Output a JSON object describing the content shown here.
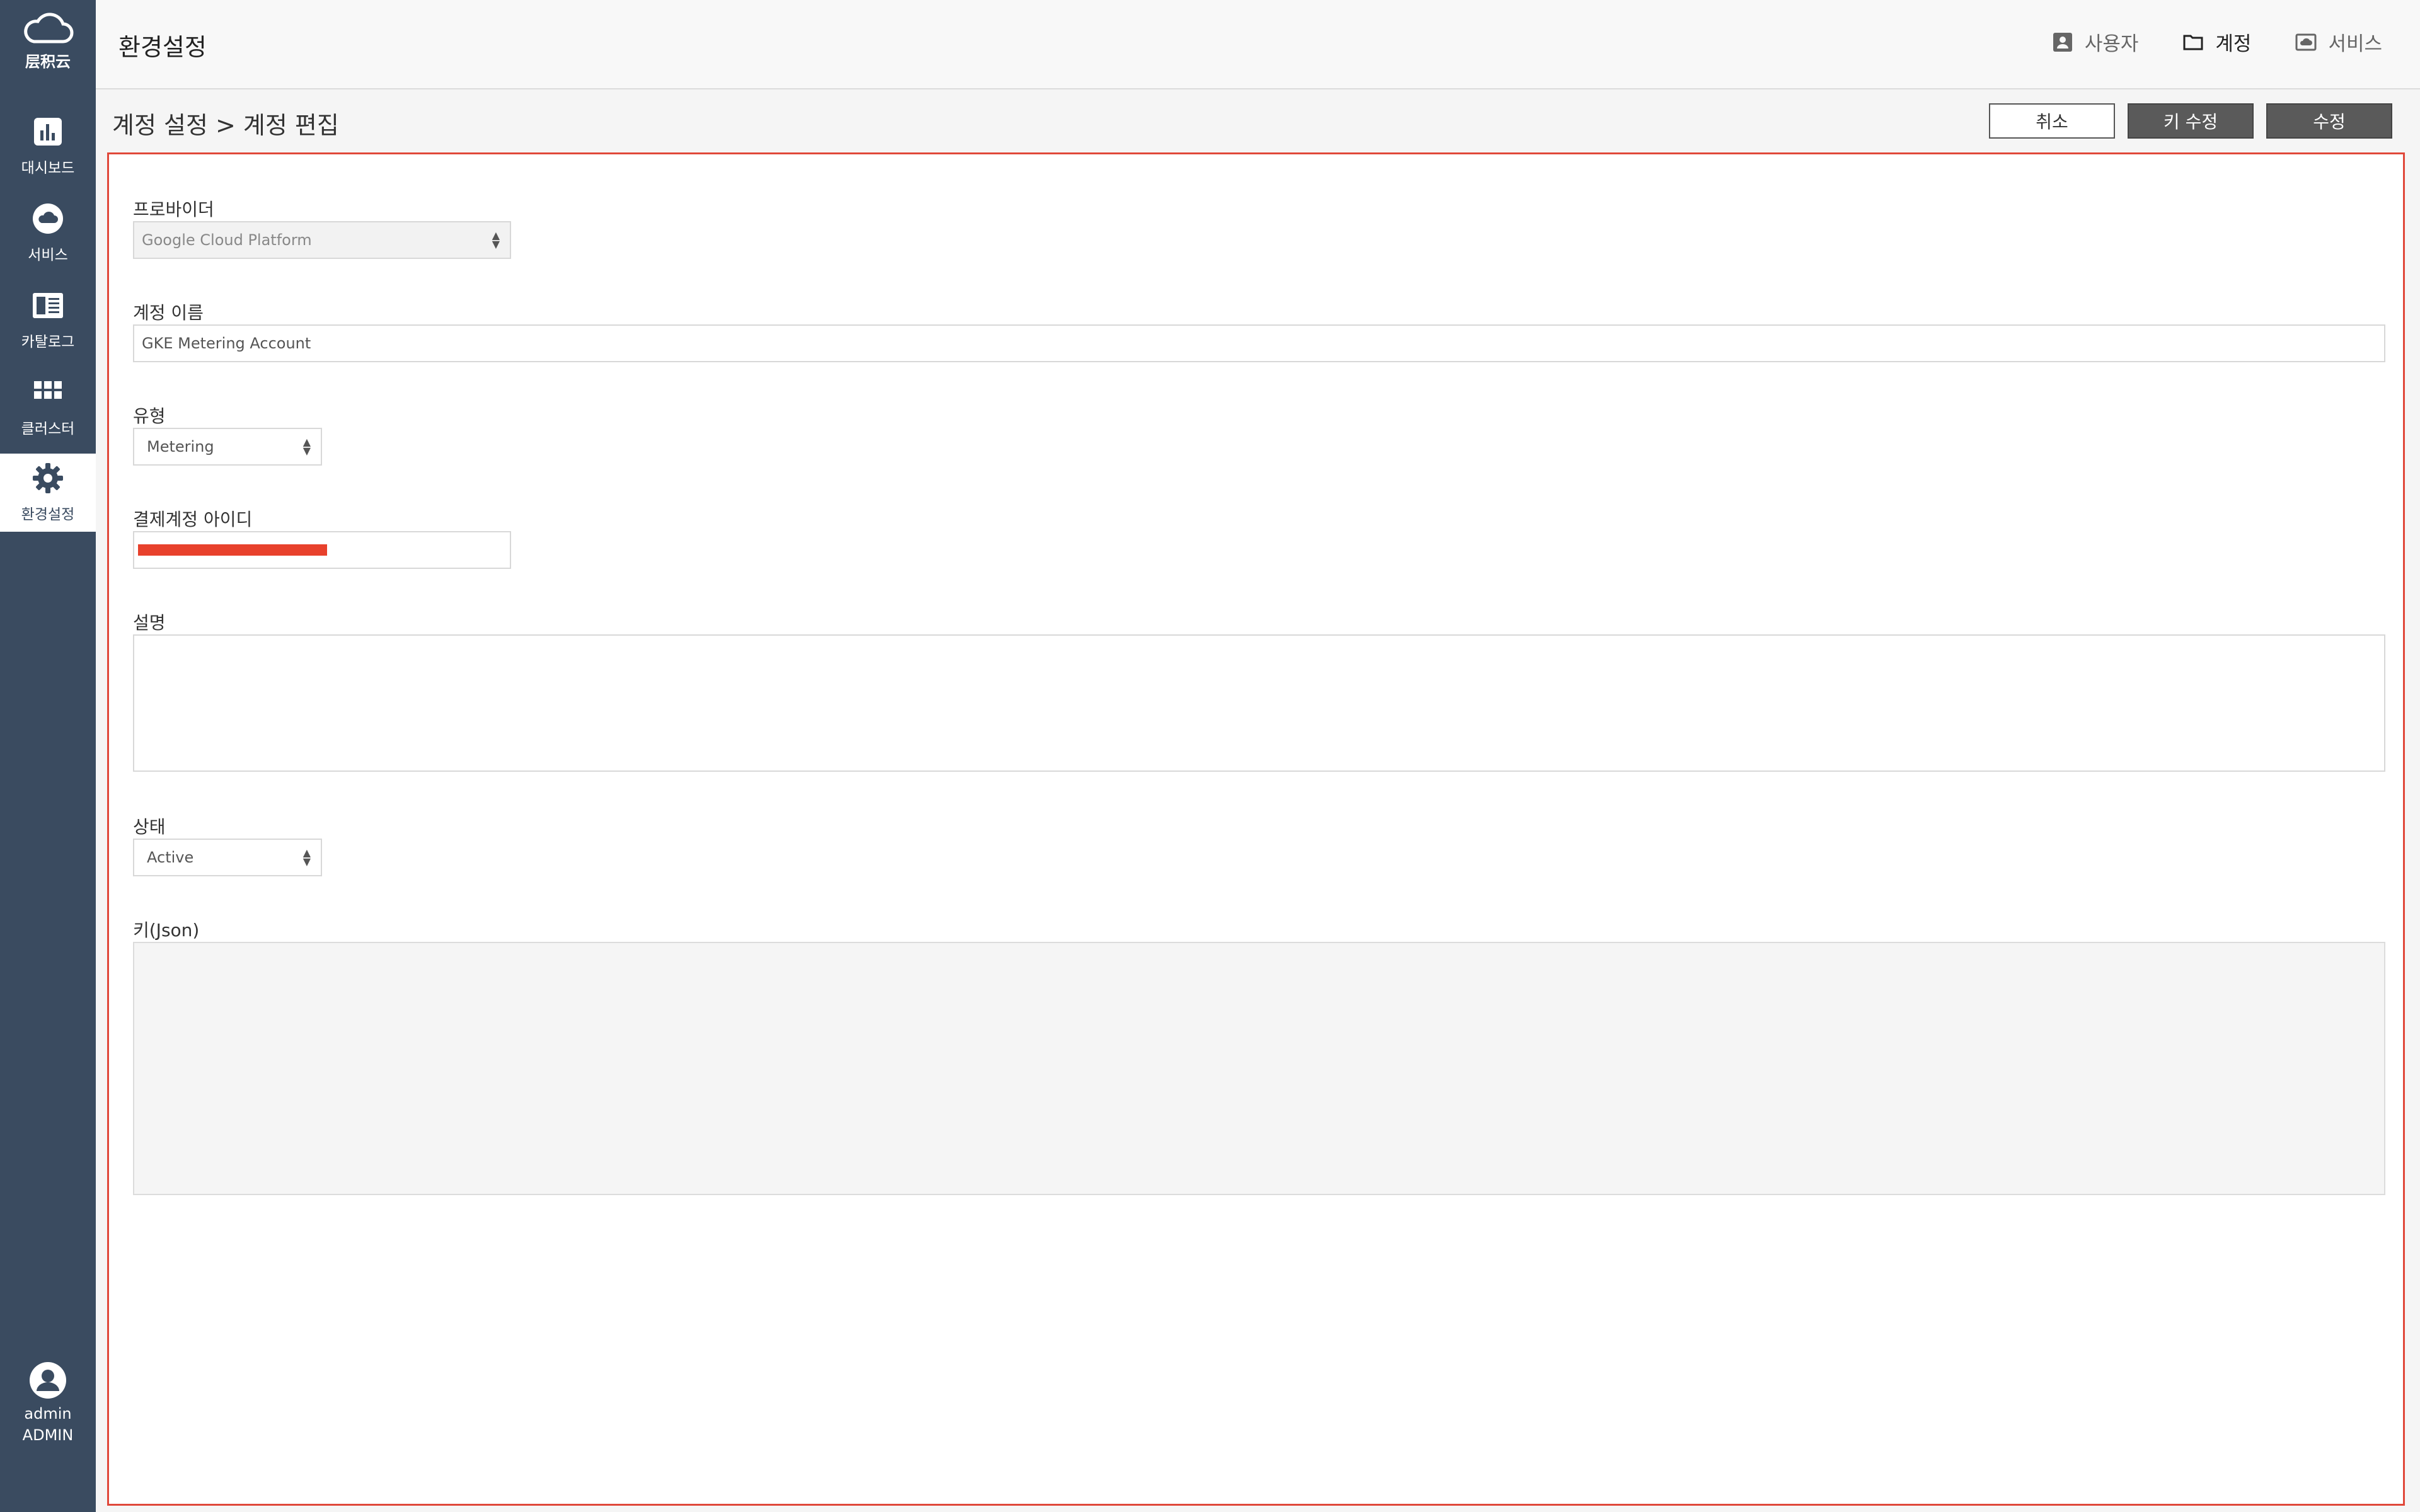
{
  "sidebar": {
    "logo_text": "层积云",
    "items": [
      {
        "label": "대시보드",
        "icon": "bar-chart-icon"
      },
      {
        "label": "서비스",
        "icon": "cloud-icon"
      },
      {
        "label": "카탈로그",
        "icon": "catalog-icon"
      },
      {
        "label": "클러스터",
        "icon": "grid-icon"
      },
      {
        "label": "환경설정",
        "icon": "gear-icon",
        "active": true
      }
    ],
    "user": {
      "name": "admin",
      "role": "ADMIN"
    }
  },
  "header": {
    "title": "환경설정",
    "nav": [
      {
        "label": "사용자",
        "icon": "user-icon"
      },
      {
        "label": "계정",
        "icon": "folder-icon",
        "active": true
      },
      {
        "label": "서비스",
        "icon": "service-icon"
      }
    ]
  },
  "page": {
    "breadcrumb": "계정 설정 > 계정 편집",
    "buttons": {
      "cancel": "취소",
      "key_edit": "키 수정",
      "save": "수정"
    }
  },
  "form": {
    "provider": {
      "label": "프로바이더",
      "value": "Google Cloud Platform"
    },
    "account_name": {
      "label": "계정 이름",
      "value": "GKE Metering Account"
    },
    "type": {
      "label": "유형",
      "value": "Metering"
    },
    "billing_id": {
      "label": "결제계정 아이디",
      "value": ""
    },
    "description": {
      "label": "설명",
      "value": ""
    },
    "status": {
      "label": "상태",
      "value": "Active"
    },
    "key_json": {
      "label": "키(Json)",
      "value": ""
    }
  },
  "colors": {
    "sidebar": "#3a4b60",
    "highlight_border": "#e0483a",
    "redaction": "#e8412c"
  }
}
